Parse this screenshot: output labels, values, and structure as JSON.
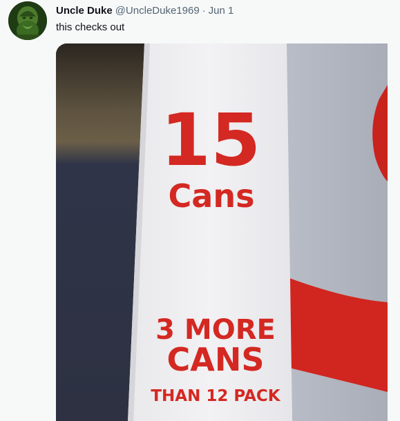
{
  "tweet": {
    "display_name": "Uncle Duke",
    "handle": "@UncleDuke1969",
    "separator": "·",
    "date": "Jun 1",
    "text": "this checks out"
  },
  "media": {
    "can_count": "15",
    "cans_label": "Cans",
    "line1": "3 MORE",
    "line2": "CANS",
    "line3": "THAN 12 PACK"
  },
  "colors": {
    "label_red": "#d42822",
    "text_primary": "#0f1419",
    "text_secondary": "#536471",
    "background": "#f7f9f9"
  }
}
